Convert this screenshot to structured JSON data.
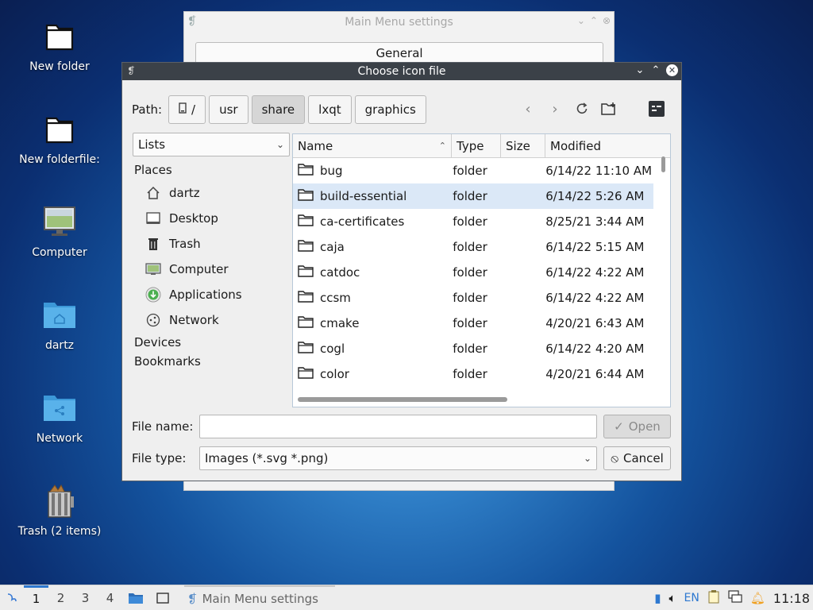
{
  "desktop": {
    "icons": [
      {
        "label": "New folder"
      },
      {
        "label": "New folderfile:"
      },
      {
        "label": "Computer"
      },
      {
        "label": "dartz"
      },
      {
        "label": "Network"
      },
      {
        "label": "Trash (2 items)"
      }
    ]
  },
  "background_window": {
    "title": "Main Menu settings",
    "general_tab": "General"
  },
  "dialog": {
    "title": "Choose icon file",
    "path_label": "Path:",
    "breadcrumbs": [
      "/",
      "usr",
      "share",
      "lxqt",
      "graphics"
    ],
    "active_crumb": "share",
    "view_select": "Lists",
    "places_header": "Places",
    "places": [
      {
        "label": "dartz",
        "icon": "home-icon"
      },
      {
        "label": "Desktop",
        "icon": "desktop-icon"
      },
      {
        "label": "Trash",
        "icon": "trash-icon"
      },
      {
        "label": "Computer",
        "icon": "computer-icon"
      },
      {
        "label": "Applications",
        "icon": "applications-icon"
      },
      {
        "label": "Network",
        "icon": "network-icon"
      }
    ],
    "devices_label": "Devices",
    "bookmarks_label": "Bookmarks",
    "columns": {
      "name": "Name",
      "type": "Type",
      "size": "Size",
      "modified": "Modified"
    },
    "files": [
      {
        "name": "bug",
        "type": "folder",
        "size": "",
        "modified": "6/14/22 11:10 AM"
      },
      {
        "name": "build-essential",
        "type": "folder",
        "size": "",
        "modified": "6/14/22 5:26 AM"
      },
      {
        "name": "ca-certificates",
        "type": "folder",
        "size": "",
        "modified": "8/25/21 3:44 AM"
      },
      {
        "name": "caja",
        "type": "folder",
        "size": "",
        "modified": "6/14/22 5:15 AM"
      },
      {
        "name": "catdoc",
        "type": "folder",
        "size": "",
        "modified": "6/14/22 4:22 AM"
      },
      {
        "name": "ccsm",
        "type": "folder",
        "size": "",
        "modified": "6/14/22 4:22 AM"
      },
      {
        "name": "cmake",
        "type": "folder",
        "size": "",
        "modified": "4/20/21 6:43 AM"
      },
      {
        "name": "cogl",
        "type": "folder",
        "size": "",
        "modified": "6/14/22 4:20 AM"
      },
      {
        "name": "color",
        "type": "folder",
        "size": "",
        "modified": "4/20/21 6:44 AM"
      }
    ],
    "selected_file": "build-essential",
    "file_name_label": "File name:",
    "file_name_value": "",
    "file_type_label": "File type:",
    "file_type_value": "Images (*.svg *.png)",
    "open_label": "Open",
    "cancel_label": "Cancel"
  },
  "taskbar": {
    "workspaces": [
      "1",
      "2",
      "3",
      "4"
    ],
    "active_workspace": "1",
    "task_label": "Main Menu settings",
    "keyboard_layout": "EN",
    "clock": "11:18"
  },
  "colors": {
    "accent": "#2d78d0",
    "selection": "#dbe8f7",
    "titlebar": "#3b4148"
  }
}
